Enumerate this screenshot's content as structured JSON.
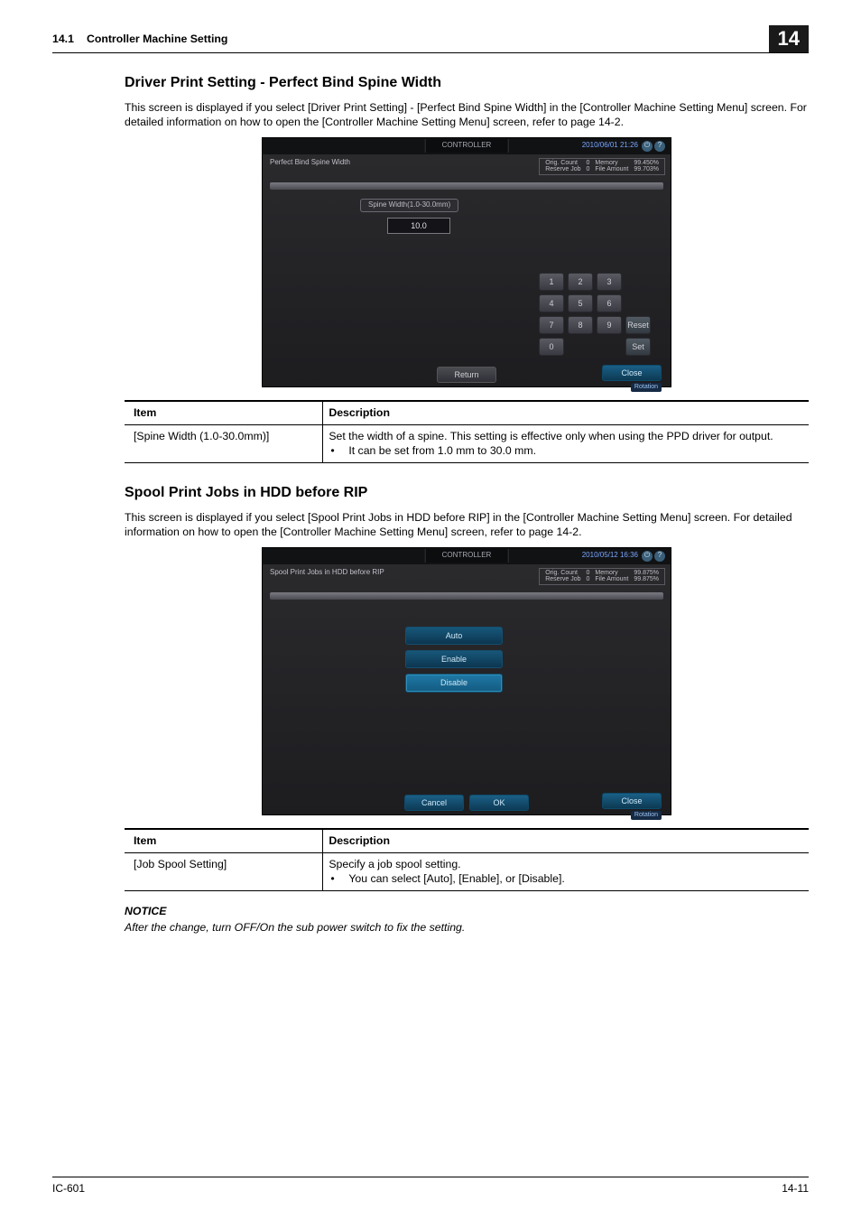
{
  "header": {
    "section_number": "14.1",
    "section_title": "Controller Machine Setting",
    "chapter_number": "14"
  },
  "section1": {
    "heading": "Driver Print Setting - Perfect Bind Spine Width",
    "paragraph": "This screen is displayed if you select [Driver Print Setting] - [Perfect Bind Spine Width] in the [Controller Machine Setting Menu] screen. For detailed information on how to open the [Controller Machine Setting Menu] screen, refer to page 14-2.",
    "screenshot": {
      "tab_label": "CONTROLLER",
      "timestamp": "2010/06/01 21:26",
      "title": "Perfect Bind Spine Width",
      "status": {
        "r1c1": "Orig. Count",
        "r1c2": "0",
        "r1c3": "Memory",
        "r1c4": "99.450%",
        "r2c1": "Reserve Job",
        "r2c2": "0",
        "r2c3": "File Amount",
        "r2c4": "99.703%"
      },
      "field_label": "Spine Width(1.0-30.0mm)",
      "field_value": "10.0",
      "keys": [
        "1",
        "2",
        "3",
        "4",
        "5",
        "6",
        "7",
        "8",
        "9",
        "0"
      ],
      "reset": "Reset",
      "set": "Set",
      "return": "Return",
      "close": "Close",
      "rotation": "Rotation"
    },
    "table": {
      "h1": "Item",
      "h2": "Description",
      "row_item": "[Spine Width (1.0-30.0mm)]",
      "row_desc_line1": "Set the width of a spine. This setting is effective only when using the PPD driver for output.",
      "row_desc_bullet": "It can be set from 1.0 mm to 30.0 mm."
    }
  },
  "section2": {
    "heading": "Spool Print Jobs in HDD before RIP",
    "paragraph": "This screen is displayed if you select [Spool Print Jobs in HDD before RIP] in the [Controller Machine Setting Menu] screen. For detailed information on how to open the [Controller Machine Setting Menu] screen, refer to page 14-2.",
    "screenshot": {
      "tab_label": "CONTROLLER",
      "timestamp": "2010/05/12 16:36",
      "title": "Spool Print Jobs in HDD before RIP",
      "status": {
        "r1c1": "Orig. Count",
        "r1c2": "0",
        "r1c3": "Memory",
        "r1c4": "99.875%",
        "r2c1": "Reserve Job",
        "r2c2": "0",
        "r2c3": "File Amount",
        "r2c4": "99.875%"
      },
      "opt_auto": "Auto",
      "opt_enable": "Enable",
      "opt_disable": "Disable",
      "cancel": "Cancel",
      "ok": "OK",
      "close": "Close",
      "rotation": "Rotation"
    },
    "table": {
      "h1": "Item",
      "h2": "Description",
      "row_item": "[Job Spool Setting]",
      "row_desc_line1": "Specify a job spool setting.",
      "row_desc_bullet": "You can select [Auto], [Enable], or [Disable]."
    },
    "notice_label": "NOTICE",
    "notice_text": "After the change, turn OFF/On the sub power switch to fix the setting."
  },
  "footer": {
    "left": "IC-601",
    "right": "14-11"
  }
}
